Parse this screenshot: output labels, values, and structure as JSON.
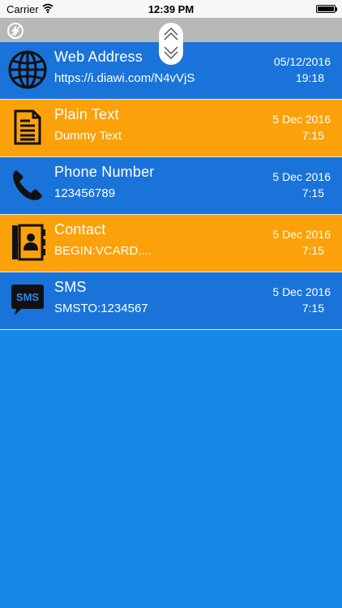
{
  "status_bar": {
    "carrier": "Carrier",
    "time": "12:39 PM"
  },
  "items": [
    {
      "title": "Web Address",
      "subtitle": "https://i.diawi.com/N4vVjS",
      "date": "05/12/2016",
      "time": "19:18",
      "color": "#1a73d9",
      "icon": "globe-icon"
    },
    {
      "title": "Plain Text",
      "subtitle": "Dummy Text",
      "date": "5 Dec 2016",
      "time": "7:15",
      "color": "#fba10a",
      "icon": "document-icon"
    },
    {
      "title": "Phone Number",
      "subtitle": "123456789",
      "date": "5 Dec 2016",
      "time": "7:15",
      "color": "#1a73d9",
      "icon": "phone-icon"
    },
    {
      "title": "Contact",
      "subtitle": "BEGIN:VCARD....",
      "date": "5 Dec 2016",
      "time": "7:15",
      "color": "#fba10a",
      "icon": "contact-book-icon"
    },
    {
      "title": "SMS",
      "subtitle": "SMSTO:1234567",
      "date": "5 Dec 2016",
      "time": "7:15",
      "color": "#1a73d9",
      "icon": "sms-icon",
      "icon_text": "SMS"
    }
  ],
  "colors": {
    "background": "#1688e6",
    "blue_row": "#1a73d9",
    "orange_row": "#fba10a",
    "nav_bar": "#b8b8b8"
  }
}
